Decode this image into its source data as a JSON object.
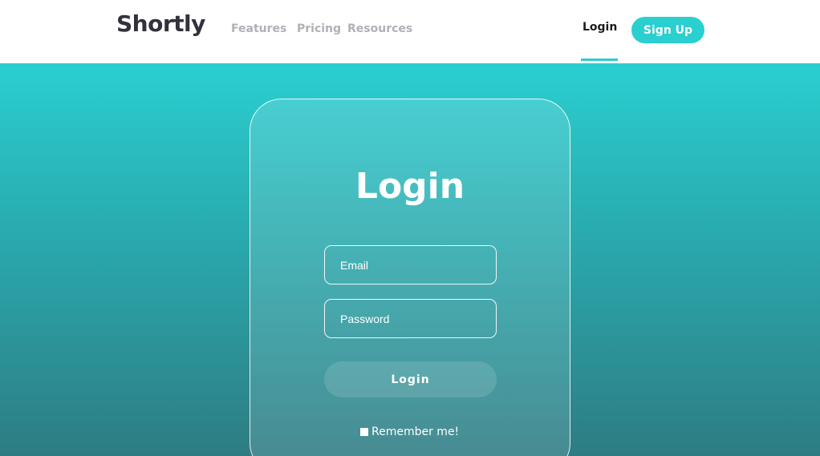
{
  "header": {
    "logo": "Shortly",
    "nav": {
      "features": "Features",
      "pricing": "Pricing",
      "resources": "Resources"
    },
    "login_label": "Login",
    "signup_label": "Sign Up"
  },
  "colors": {
    "accent": "#2acfcf",
    "logo_text": "#34313d",
    "nav_text": "#b0b0b6",
    "hero_top": "#2acfd1",
    "hero_bottom": "#2e7c83"
  },
  "login_card": {
    "title": "Login",
    "email_placeholder": "Email",
    "password_placeholder": "Password",
    "submit_label": "Login",
    "remember_label": "Remember me!"
  }
}
